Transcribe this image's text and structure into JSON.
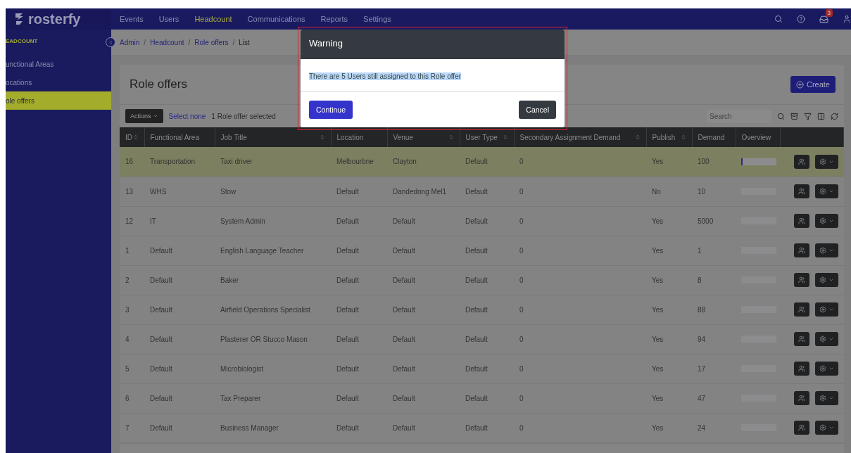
{
  "nav": {
    "logo": "rosterfy",
    "items": [
      {
        "label": "Events",
        "selected": false
      },
      {
        "label": "Users",
        "selected": false
      },
      {
        "label": "Headcount",
        "selected": true
      },
      {
        "label": "Communications",
        "selected": false
      },
      {
        "label": "Reports",
        "selected": false
      },
      {
        "label": "Settings",
        "selected": false
      }
    ],
    "notification_count": "3"
  },
  "sidebar": {
    "heading": "EADCOUNT",
    "items": [
      {
        "label": "unctional Areas",
        "selected": false
      },
      {
        "label": "ocations",
        "selected": false
      },
      {
        "label": "ole offers",
        "selected": true
      }
    ]
  },
  "breadcrumb": {
    "separator": "/",
    "items": [
      {
        "label": "Admin",
        "kind": "link"
      },
      {
        "label": "Headcount",
        "kind": "link"
      },
      {
        "label": "Role offers",
        "kind": "link"
      },
      {
        "label": "List",
        "kind": "current"
      }
    ]
  },
  "page": {
    "title": "Role offers",
    "create_button": "Create"
  },
  "toolbar": {
    "actions_button": "Actions",
    "select_none": "Select none",
    "selection_text": "1 Role offer selected",
    "search_placeholder": "Search"
  },
  "table": {
    "columns": [
      {
        "label": "ID",
        "sortable": true
      },
      {
        "label": "Functional Area",
        "sortable": false
      },
      {
        "label": "Job Title",
        "sortable": true
      },
      {
        "label": "Location",
        "sortable": false
      },
      {
        "label": "Venue",
        "sortable": true
      },
      {
        "label": "User Type",
        "sortable": true
      },
      {
        "label": "Secondary Assignment Demand",
        "sortable": true
      },
      {
        "label": "Publish",
        "sortable": true
      },
      {
        "label": "Demand",
        "sortable": false
      },
      {
        "label": "Overview",
        "sortable": false
      }
    ],
    "rows": [
      {
        "id": "16",
        "functional_area": "Transportation",
        "job_title": "Taxi driver",
        "location": "Melbourbne",
        "venue": "Clayton",
        "user_type": "Default",
        "secondary_demand": "0",
        "publish": "Yes",
        "demand": "100",
        "level": 0.03,
        "selected": true
      },
      {
        "id": "13",
        "functional_area": "WHS",
        "job_title": "Stow",
        "location": "Default",
        "venue": "Dandedong Mel1",
        "user_type": "Default",
        "secondary_demand": "0",
        "publish": "No",
        "demand": "10",
        "selected": false
      },
      {
        "id": "12",
        "functional_area": "IT",
        "job_title": "System Admin",
        "location": "Default",
        "venue": "Default",
        "user_type": "Default",
        "secondary_demand": "0",
        "publish": "Yes",
        "demand": "5000",
        "selected": false
      },
      {
        "id": "1",
        "functional_area": "Default",
        "job_title": "English Language Teacher",
        "location": "Default",
        "venue": "Default",
        "user_type": "Default",
        "secondary_demand": "0",
        "publish": "Yes",
        "demand": "1",
        "selected": false
      },
      {
        "id": "2",
        "functional_area": "Default",
        "job_title": "Baker",
        "location": "Default",
        "venue": "Default",
        "user_type": "Default",
        "secondary_demand": "0",
        "publish": "Yes",
        "demand": "8",
        "selected": false
      },
      {
        "id": "3",
        "functional_area": "Default",
        "job_title": "Airfield Operations Specialist",
        "location": "Default",
        "venue": "Default",
        "user_type": "Default",
        "secondary_demand": "0",
        "publish": "Yes",
        "demand": "88",
        "selected": false
      },
      {
        "id": "4",
        "functional_area": "Default",
        "job_title": "Plasterer OR Stucco Mason",
        "location": "Default",
        "venue": "Default",
        "user_type": "Default",
        "secondary_demand": "0",
        "publish": "Yes",
        "demand": "94",
        "selected": false
      },
      {
        "id": "5",
        "functional_area": "Default",
        "job_title": "Microbiologist",
        "location": "Default",
        "venue": "Default",
        "user_type": "Default",
        "secondary_demand": "0",
        "publish": "Yes",
        "demand": "17",
        "selected": false
      },
      {
        "id": "6",
        "functional_area": "Default",
        "job_title": "Tax Preparer",
        "location": "Default",
        "venue": "Default",
        "user_type": "Default",
        "secondary_demand": "0",
        "publish": "Yes",
        "demand": "47",
        "selected": false
      },
      {
        "id": "7",
        "functional_area": "Default",
        "job_title": "Business Manager",
        "location": "Default",
        "venue": "Default",
        "user_type": "Default",
        "secondary_demand": "0",
        "publish": "Yes",
        "demand": "24",
        "selected": false
      }
    ]
  },
  "dialog": {
    "title": "Warning",
    "message": "There are 5 Users still assigned to this Role offer",
    "buttons": [
      {
        "label": "Continue",
        "kind": "primary"
      },
      {
        "label": "Cancel",
        "kind": "secondary"
      }
    ]
  }
}
